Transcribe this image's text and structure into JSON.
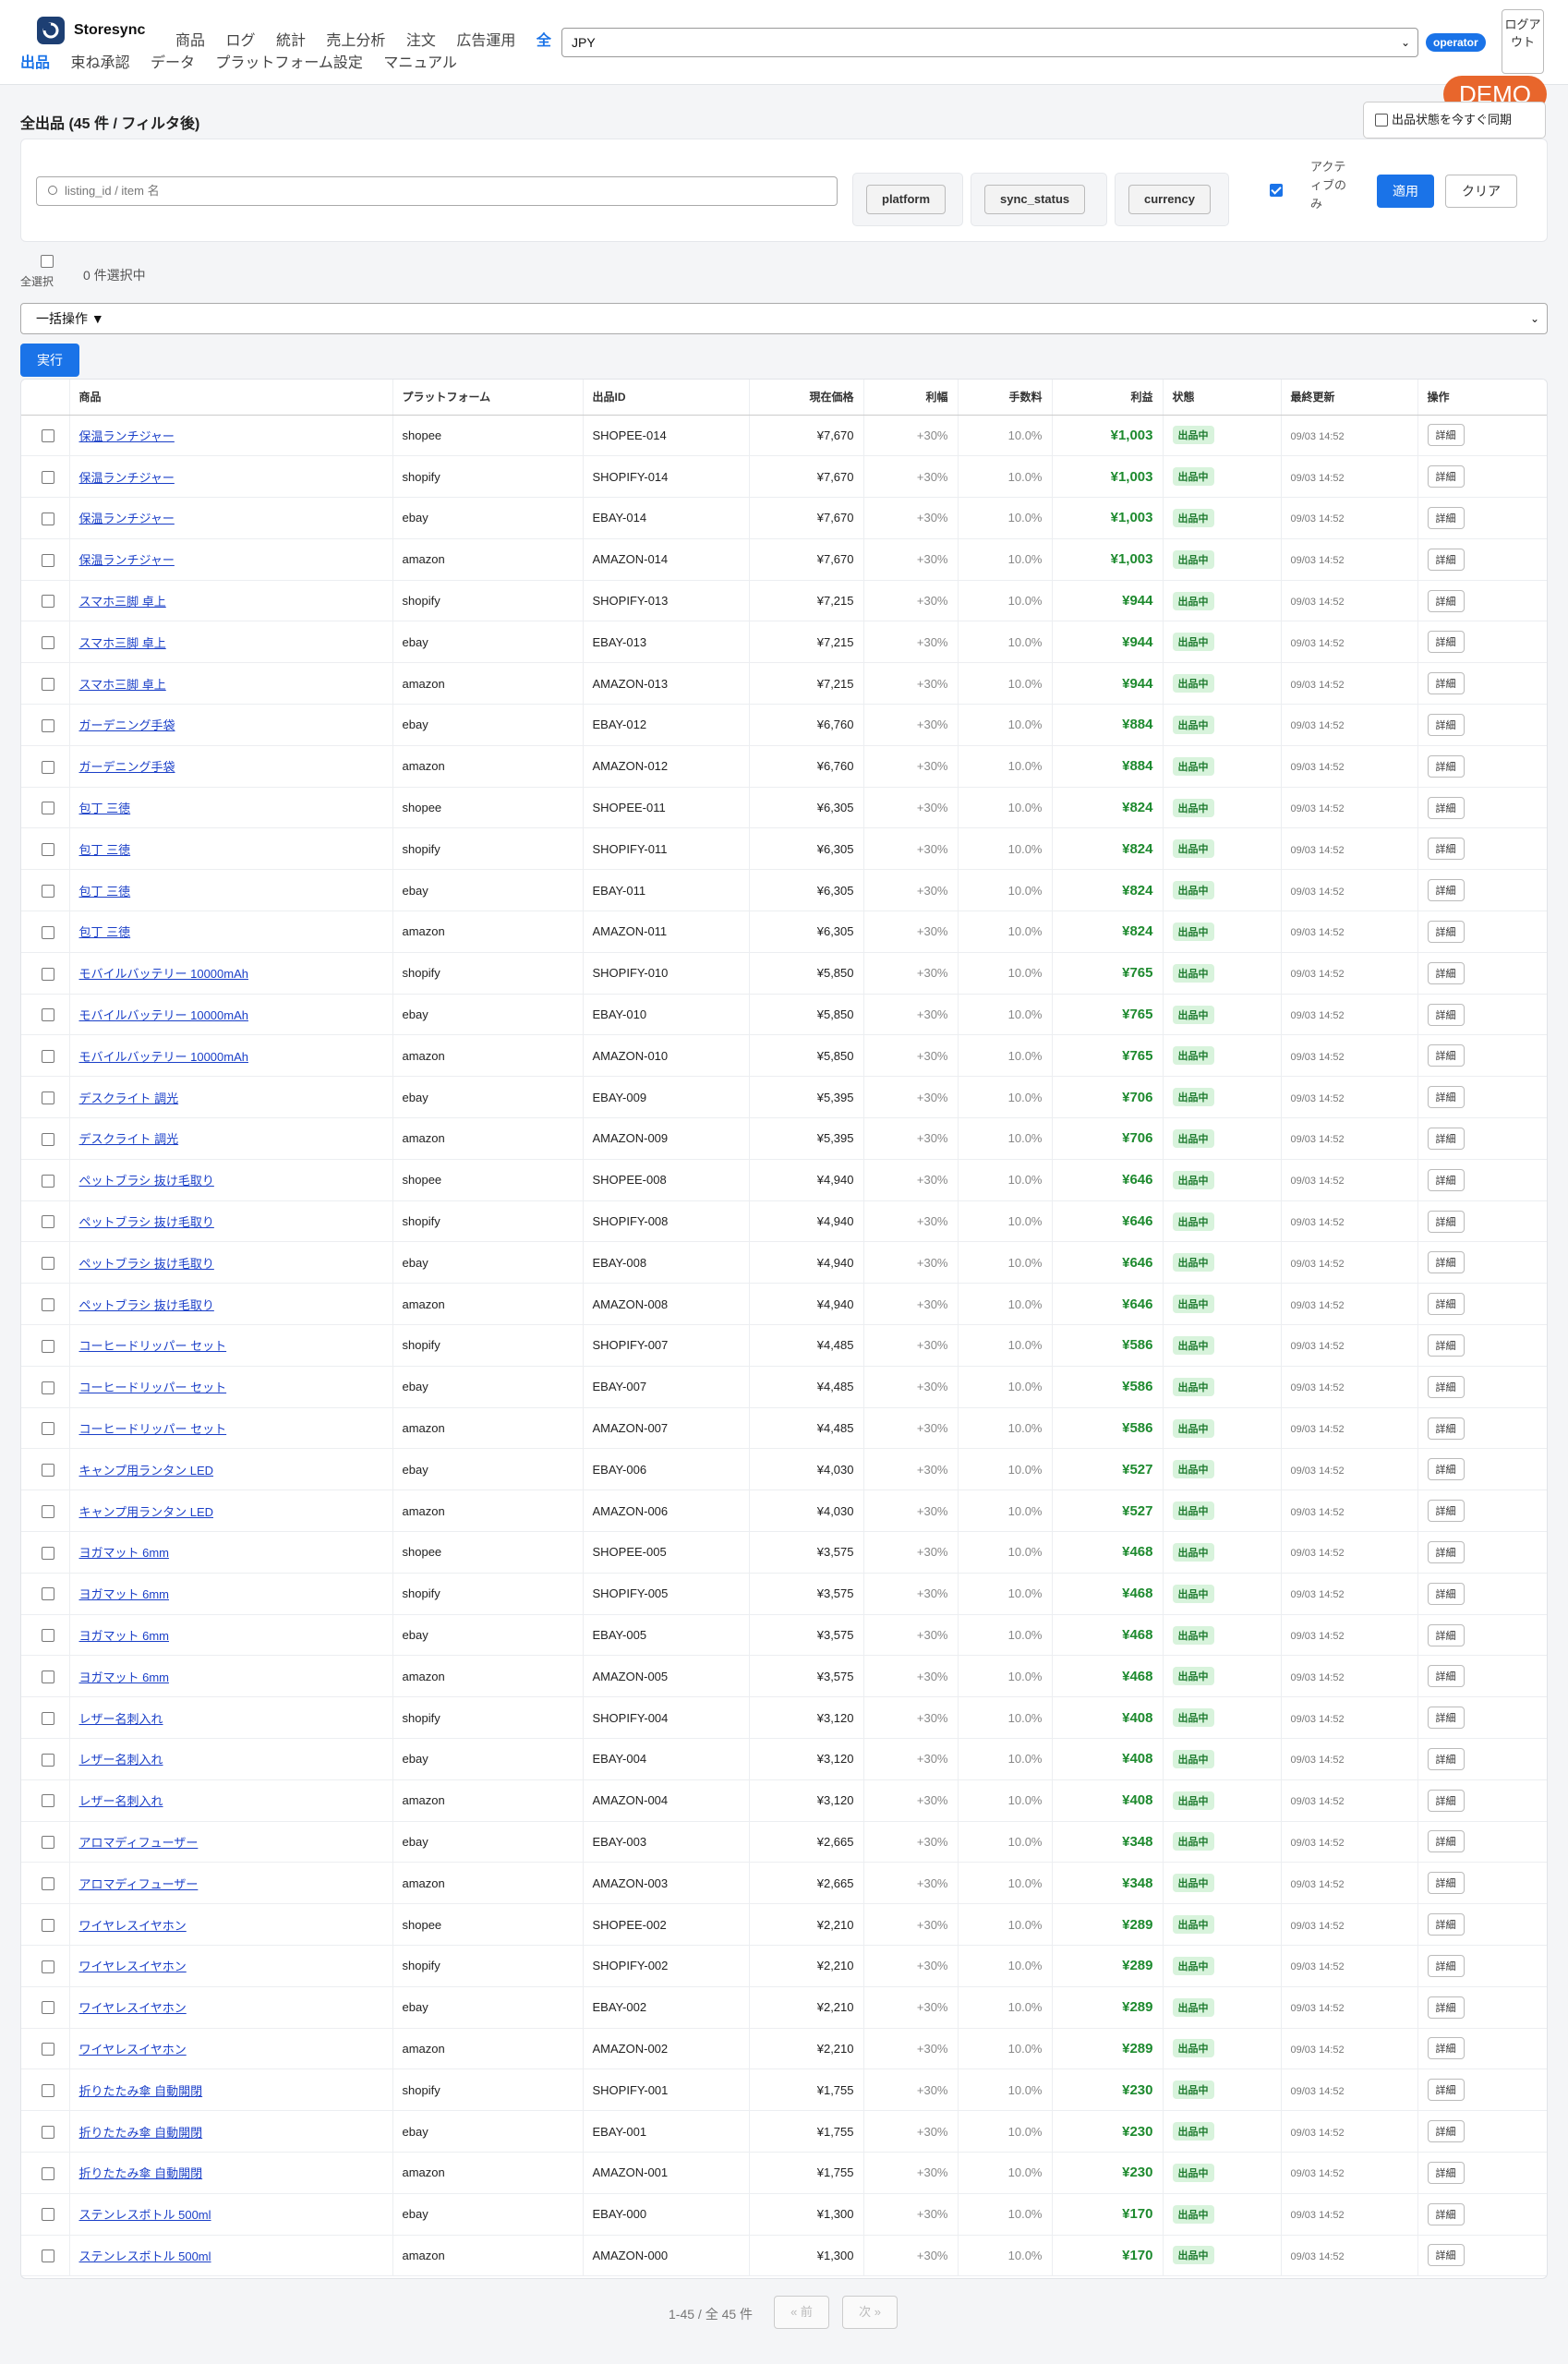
{
  "app": {
    "name": "Storesync"
  },
  "nav": {
    "row1": [
      "商品",
      "ログ",
      "統計",
      "売上分析",
      "注文",
      "広告運用"
    ],
    "row1_active": "全",
    "row2_active": "出品",
    "row2": [
      "束ね承認",
      "データ",
      "プラットフォーム設定",
      "マニュアル"
    ]
  },
  "header": {
    "currency": "JPY",
    "role": "operator",
    "logout": "ログアウト",
    "demo": "DEMO"
  },
  "page": {
    "title": "全出品 (45 件 / フィルタ後)",
    "sync_button": "出品状態を今すぐ同期"
  },
  "filters": {
    "search_placeholder": "listing_id / item 名",
    "platform": "platform",
    "sync_status": "sync_status",
    "currency": "currency",
    "active_only": "アクティブのみ",
    "apply": "適用",
    "clear": "クリア"
  },
  "selection": {
    "select_all": "全選択",
    "count": "0 件選択中",
    "bulk_action": "一括操作 ▼",
    "execute": "実行"
  },
  "table": {
    "columns": [
      "商品",
      "プラットフォーム",
      "出品ID",
      "現在価格",
      "利幅",
      "手数料",
      "利益",
      "状態",
      "最終更新",
      "操作"
    ],
    "rows": [
      {
        "item": "保温ランチジャー",
        "platform": "shopee",
        "id": "SHOPEE-014",
        "price": "¥7,670",
        "margin": "+30%",
        "fee": "10.0%",
        "profit": "¥1,003",
        "status": "出品中",
        "updated": "09/03 14:52",
        "action": "詳細"
      },
      {
        "item": "保温ランチジャー",
        "platform": "shopify",
        "id": "SHOPIFY-014",
        "price": "¥7,670",
        "margin": "+30%",
        "fee": "10.0%",
        "profit": "¥1,003",
        "status": "出品中",
        "updated": "09/03 14:52",
        "action": "詳細"
      },
      {
        "item": "保温ランチジャー",
        "platform": "ebay",
        "id": "EBAY-014",
        "price": "¥7,670",
        "margin": "+30%",
        "fee": "10.0%",
        "profit": "¥1,003",
        "status": "出品中",
        "updated": "09/03 14:52",
        "action": "詳細"
      },
      {
        "item": "保温ランチジャー",
        "platform": "amazon",
        "id": "AMAZON-014",
        "price": "¥7,670",
        "margin": "+30%",
        "fee": "10.0%",
        "profit": "¥1,003",
        "status": "出品中",
        "updated": "09/03 14:52",
        "action": "詳細"
      },
      {
        "item": "スマホ三脚 卓上",
        "platform": "shopify",
        "id": "SHOPIFY-013",
        "price": "¥7,215",
        "margin": "+30%",
        "fee": "10.0%",
        "profit": "¥944",
        "status": "出品中",
        "updated": "09/03 14:52",
        "action": "詳細"
      },
      {
        "item": "スマホ三脚 卓上",
        "platform": "ebay",
        "id": "EBAY-013",
        "price": "¥7,215",
        "margin": "+30%",
        "fee": "10.0%",
        "profit": "¥944",
        "status": "出品中",
        "updated": "09/03 14:52",
        "action": "詳細"
      },
      {
        "item": "スマホ三脚 卓上",
        "platform": "amazon",
        "id": "AMAZON-013",
        "price": "¥7,215",
        "margin": "+30%",
        "fee": "10.0%",
        "profit": "¥944",
        "status": "出品中",
        "updated": "09/03 14:52",
        "action": "詳細"
      },
      {
        "item": "ガーデニング手袋",
        "platform": "ebay",
        "id": "EBAY-012",
        "price": "¥6,760",
        "margin": "+30%",
        "fee": "10.0%",
        "profit": "¥884",
        "status": "出品中",
        "updated": "09/03 14:52",
        "action": "詳細"
      },
      {
        "item": "ガーデニング手袋",
        "platform": "amazon",
        "id": "AMAZON-012",
        "price": "¥6,760",
        "margin": "+30%",
        "fee": "10.0%",
        "profit": "¥884",
        "status": "出品中",
        "updated": "09/03 14:52",
        "action": "詳細"
      },
      {
        "item": "包丁 三徳",
        "platform": "shopee",
        "id": "SHOPEE-011",
        "price": "¥6,305",
        "margin": "+30%",
        "fee": "10.0%",
        "profit": "¥824",
        "status": "出品中",
        "updated": "09/03 14:52",
        "action": "詳細"
      },
      {
        "item": "包丁 三徳",
        "platform": "shopify",
        "id": "SHOPIFY-011",
        "price": "¥6,305",
        "margin": "+30%",
        "fee": "10.0%",
        "profit": "¥824",
        "status": "出品中",
        "updated": "09/03 14:52",
        "action": "詳細"
      },
      {
        "item": "包丁 三徳",
        "platform": "ebay",
        "id": "EBAY-011",
        "price": "¥6,305",
        "margin": "+30%",
        "fee": "10.0%",
        "profit": "¥824",
        "status": "出品中",
        "updated": "09/03 14:52",
        "action": "詳細"
      },
      {
        "item": "包丁 三徳",
        "platform": "amazon",
        "id": "AMAZON-011",
        "price": "¥6,305",
        "margin": "+30%",
        "fee": "10.0%",
        "profit": "¥824",
        "status": "出品中",
        "updated": "09/03 14:52",
        "action": "詳細"
      },
      {
        "item": "モバイルバッテリー 10000mAh",
        "platform": "shopify",
        "id": "SHOPIFY-010",
        "price": "¥5,850",
        "margin": "+30%",
        "fee": "10.0%",
        "profit": "¥765",
        "status": "出品中",
        "updated": "09/03 14:52",
        "action": "詳細"
      },
      {
        "item": "モバイルバッテリー 10000mAh",
        "platform": "ebay",
        "id": "EBAY-010",
        "price": "¥5,850",
        "margin": "+30%",
        "fee": "10.0%",
        "profit": "¥765",
        "status": "出品中",
        "updated": "09/03 14:52",
        "action": "詳細"
      },
      {
        "item": "モバイルバッテリー 10000mAh",
        "platform": "amazon",
        "id": "AMAZON-010",
        "price": "¥5,850",
        "margin": "+30%",
        "fee": "10.0%",
        "profit": "¥765",
        "status": "出品中",
        "updated": "09/03 14:52",
        "action": "詳細"
      },
      {
        "item": "デスクライト 調光",
        "platform": "ebay",
        "id": "EBAY-009",
        "price": "¥5,395",
        "margin": "+30%",
        "fee": "10.0%",
        "profit": "¥706",
        "status": "出品中",
        "updated": "09/03 14:52",
        "action": "詳細"
      },
      {
        "item": "デスクライト 調光",
        "platform": "amazon",
        "id": "AMAZON-009",
        "price": "¥5,395",
        "margin": "+30%",
        "fee": "10.0%",
        "profit": "¥706",
        "status": "出品中",
        "updated": "09/03 14:52",
        "action": "詳細"
      },
      {
        "item": "ペットブラシ 抜け毛取り",
        "platform": "shopee",
        "id": "SHOPEE-008",
        "price": "¥4,940",
        "margin": "+30%",
        "fee": "10.0%",
        "profit": "¥646",
        "status": "出品中",
        "updated": "09/03 14:52",
        "action": "詳細"
      },
      {
        "item": "ペットブラシ 抜け毛取り",
        "platform": "shopify",
        "id": "SHOPIFY-008",
        "price": "¥4,940",
        "margin": "+30%",
        "fee": "10.0%",
        "profit": "¥646",
        "status": "出品中",
        "updated": "09/03 14:52",
        "action": "詳細"
      },
      {
        "item": "ペットブラシ 抜け毛取り",
        "platform": "ebay",
        "id": "EBAY-008",
        "price": "¥4,940",
        "margin": "+30%",
        "fee": "10.0%",
        "profit": "¥646",
        "status": "出品中",
        "updated": "09/03 14:52",
        "action": "詳細"
      },
      {
        "item": "ペットブラシ 抜け毛取り",
        "platform": "amazon",
        "id": "AMAZON-008",
        "price": "¥4,940",
        "margin": "+30%",
        "fee": "10.0%",
        "profit": "¥646",
        "status": "出品中",
        "updated": "09/03 14:52",
        "action": "詳細"
      },
      {
        "item": "コーヒードリッパー セット",
        "platform": "shopify",
        "id": "SHOPIFY-007",
        "price": "¥4,485",
        "margin": "+30%",
        "fee": "10.0%",
        "profit": "¥586",
        "status": "出品中",
        "updated": "09/03 14:52",
        "action": "詳細"
      },
      {
        "item": "コーヒードリッパー セット",
        "platform": "ebay",
        "id": "EBAY-007",
        "price": "¥4,485",
        "margin": "+30%",
        "fee": "10.0%",
        "profit": "¥586",
        "status": "出品中",
        "updated": "09/03 14:52",
        "action": "詳細"
      },
      {
        "item": "コーヒードリッパー セット",
        "platform": "amazon",
        "id": "AMAZON-007",
        "price": "¥4,485",
        "margin": "+30%",
        "fee": "10.0%",
        "profit": "¥586",
        "status": "出品中",
        "updated": "09/03 14:52",
        "action": "詳細"
      },
      {
        "item": "キャンプ用ランタン LED",
        "platform": "ebay",
        "id": "EBAY-006",
        "price": "¥4,030",
        "margin": "+30%",
        "fee": "10.0%",
        "profit": "¥527",
        "status": "出品中",
        "updated": "09/03 14:52",
        "action": "詳細"
      },
      {
        "item": "キャンプ用ランタン LED",
        "platform": "amazon",
        "id": "AMAZON-006",
        "price": "¥4,030",
        "margin": "+30%",
        "fee": "10.0%",
        "profit": "¥527",
        "status": "出品中",
        "updated": "09/03 14:52",
        "action": "詳細"
      },
      {
        "item": "ヨガマット 6mm",
        "platform": "shopee",
        "id": "SHOPEE-005",
        "price": "¥3,575",
        "margin": "+30%",
        "fee": "10.0%",
        "profit": "¥468",
        "status": "出品中",
        "updated": "09/03 14:52",
        "action": "詳細"
      },
      {
        "item": "ヨガマット 6mm",
        "platform": "shopify",
        "id": "SHOPIFY-005",
        "price": "¥3,575",
        "margin": "+30%",
        "fee": "10.0%",
        "profit": "¥468",
        "status": "出品中",
        "updated": "09/03 14:52",
        "action": "詳細"
      },
      {
        "item": "ヨガマット 6mm",
        "platform": "ebay",
        "id": "EBAY-005",
        "price": "¥3,575",
        "margin": "+30%",
        "fee": "10.0%",
        "profit": "¥468",
        "status": "出品中",
        "updated": "09/03 14:52",
        "action": "詳細"
      },
      {
        "item": "ヨガマット 6mm",
        "platform": "amazon",
        "id": "AMAZON-005",
        "price": "¥3,575",
        "margin": "+30%",
        "fee": "10.0%",
        "profit": "¥468",
        "status": "出品中",
        "updated": "09/03 14:52",
        "action": "詳細"
      },
      {
        "item": "レザー名刺入れ",
        "platform": "shopify",
        "id": "SHOPIFY-004",
        "price": "¥3,120",
        "margin": "+30%",
        "fee": "10.0%",
        "profit": "¥408",
        "status": "出品中",
        "updated": "09/03 14:52",
        "action": "詳細"
      },
      {
        "item": "レザー名刺入れ",
        "platform": "ebay",
        "id": "EBAY-004",
        "price": "¥3,120",
        "margin": "+30%",
        "fee": "10.0%",
        "profit": "¥408",
        "status": "出品中",
        "updated": "09/03 14:52",
        "action": "詳細"
      },
      {
        "item": "レザー名刺入れ",
        "platform": "amazon",
        "id": "AMAZON-004",
        "price": "¥3,120",
        "margin": "+30%",
        "fee": "10.0%",
        "profit": "¥408",
        "status": "出品中",
        "updated": "09/03 14:52",
        "action": "詳細"
      },
      {
        "item": "アロマディフューザー",
        "platform": "ebay",
        "id": "EBAY-003",
        "price": "¥2,665",
        "margin": "+30%",
        "fee": "10.0%",
        "profit": "¥348",
        "status": "出品中",
        "updated": "09/03 14:52",
        "action": "詳細"
      },
      {
        "item": "アロマディフューザー",
        "platform": "amazon",
        "id": "AMAZON-003",
        "price": "¥2,665",
        "margin": "+30%",
        "fee": "10.0%",
        "profit": "¥348",
        "status": "出品中",
        "updated": "09/03 14:52",
        "action": "詳細"
      },
      {
        "item": "ワイヤレスイヤホン",
        "platform": "shopee",
        "id": "SHOPEE-002",
        "price": "¥2,210",
        "margin": "+30%",
        "fee": "10.0%",
        "profit": "¥289",
        "status": "出品中",
        "updated": "09/03 14:52",
        "action": "詳細"
      },
      {
        "item": "ワイヤレスイヤホン",
        "platform": "shopify",
        "id": "SHOPIFY-002",
        "price": "¥2,210",
        "margin": "+30%",
        "fee": "10.0%",
        "profit": "¥289",
        "status": "出品中",
        "updated": "09/03 14:52",
        "action": "詳細"
      },
      {
        "item": "ワイヤレスイヤホン",
        "platform": "ebay",
        "id": "EBAY-002",
        "price": "¥2,210",
        "margin": "+30%",
        "fee": "10.0%",
        "profit": "¥289",
        "status": "出品中",
        "updated": "09/03 14:52",
        "action": "詳細"
      },
      {
        "item": "ワイヤレスイヤホン",
        "platform": "amazon",
        "id": "AMAZON-002",
        "price": "¥2,210",
        "margin": "+30%",
        "fee": "10.0%",
        "profit": "¥289",
        "status": "出品中",
        "updated": "09/03 14:52",
        "action": "詳細"
      },
      {
        "item": "折りたたみ傘 自動開閉",
        "platform": "shopify",
        "id": "SHOPIFY-001",
        "price": "¥1,755",
        "margin": "+30%",
        "fee": "10.0%",
        "profit": "¥230",
        "status": "出品中",
        "updated": "09/03 14:52",
        "action": "詳細"
      },
      {
        "item": "折りたたみ傘 自動開閉",
        "platform": "ebay",
        "id": "EBAY-001",
        "price": "¥1,755",
        "margin": "+30%",
        "fee": "10.0%",
        "profit": "¥230",
        "status": "出品中",
        "updated": "09/03 14:52",
        "action": "詳細"
      },
      {
        "item": "折りたたみ傘 自動開閉",
        "platform": "amazon",
        "id": "AMAZON-001",
        "price": "¥1,755",
        "margin": "+30%",
        "fee": "10.0%",
        "profit": "¥230",
        "status": "出品中",
        "updated": "09/03 14:52",
        "action": "詳細"
      },
      {
        "item": "ステンレスボトル 500ml",
        "platform": "ebay",
        "id": "EBAY-000",
        "price": "¥1,300",
        "margin": "+30%",
        "fee": "10.0%",
        "profit": "¥170",
        "status": "出品中",
        "updated": "09/03 14:52",
        "action": "詳細"
      },
      {
        "item": "ステンレスボトル 500ml",
        "platform": "amazon",
        "id": "AMAZON-000",
        "price": "¥1,300",
        "margin": "+30%",
        "fee": "10.0%",
        "profit": "¥170",
        "status": "出品中",
        "updated": "09/03 14:52",
        "action": "詳細"
      }
    ]
  },
  "pagination": {
    "info": "1-45 / 全 45 件",
    "prev": "« 前",
    "next": "次 »"
  },
  "colors": {
    "accent": "#1a73e8",
    "profit": "#1d8a2e",
    "status_bg": "#d8f3dc",
    "demo": "#e8662c",
    "brand": "#1d3f73"
  }
}
